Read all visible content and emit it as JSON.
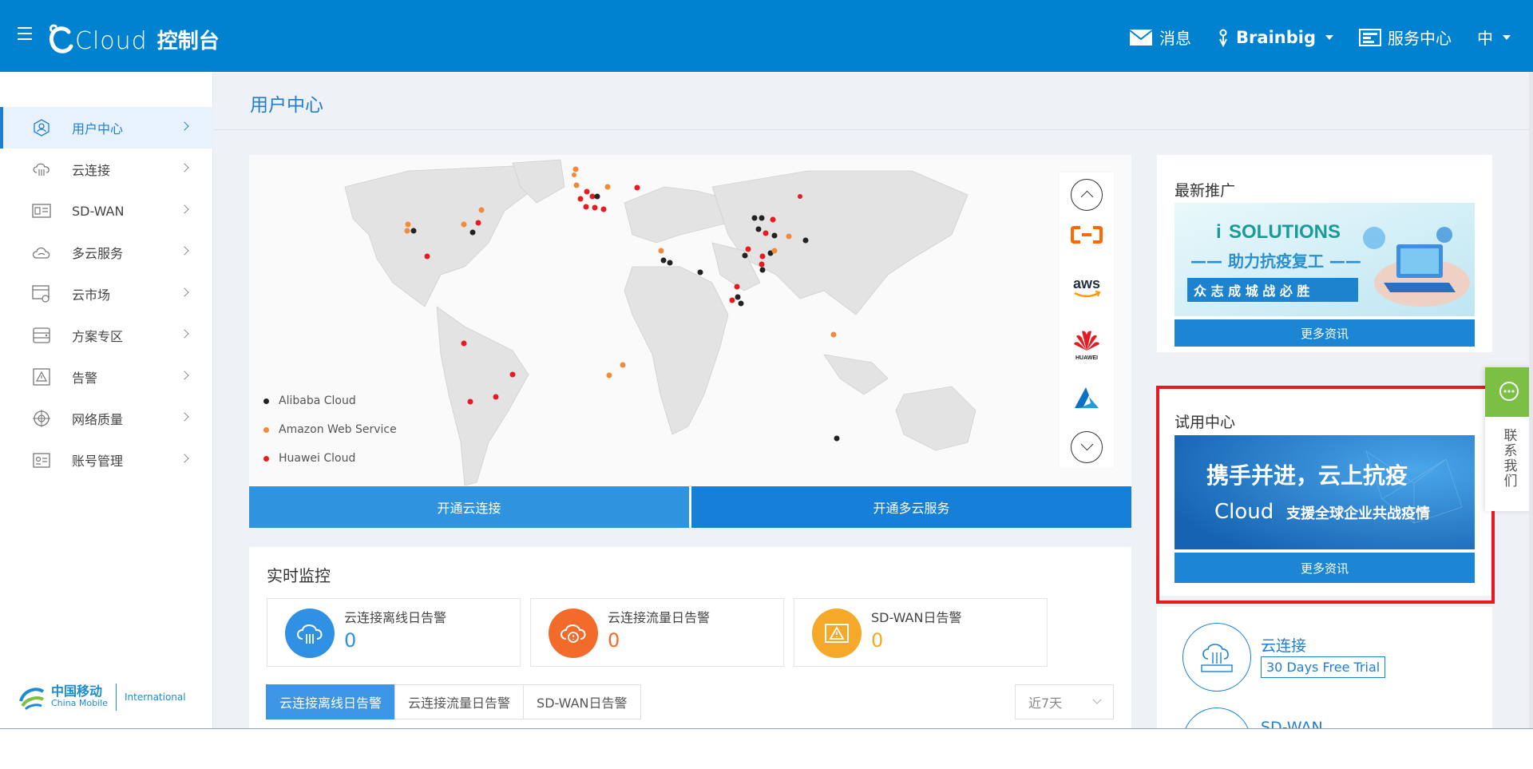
{
  "header": {
    "logo_text": "Cloud",
    "title": "控制台",
    "nav": {
      "messages": "消息",
      "user": "Brainbig",
      "service_center": "服务中心",
      "language": "中"
    }
  },
  "sidebar": {
    "items": [
      {
        "label": "用户中心",
        "icon": "user-center-icon"
      },
      {
        "label": "云连接",
        "icon": "cloud-connect-icon"
      },
      {
        "label": "SD-WAN",
        "icon": "sdwan-icon"
      },
      {
        "label": "多云服务",
        "icon": "multi-cloud-icon"
      },
      {
        "label": "云市场",
        "icon": "cloud-market-icon"
      },
      {
        "label": "方案专区",
        "icon": "solutions-icon"
      },
      {
        "label": "告警",
        "icon": "alarm-icon"
      },
      {
        "label": "网络质量",
        "icon": "network-quality-icon"
      },
      {
        "label": "账号管理",
        "icon": "account-icon"
      }
    ],
    "brand": {
      "cn": "中国移动",
      "en": "China Mobile",
      "intl": "International"
    }
  },
  "page": {
    "title": "用户中心"
  },
  "map": {
    "legend": [
      {
        "label": "Alibaba Cloud",
        "color": "#222222"
      },
      {
        "label": "Amazon Web Service",
        "color": "#f08b3a"
      },
      {
        "label": "Huawei Cloud",
        "color": "#e51b23"
      }
    ],
    "providers": [
      "alibaba-cloud-logo",
      "aws-logo",
      "huawei-logo",
      "azure-logo"
    ],
    "aws_text": "aws",
    "huawei_text": "HUAWEI",
    "buttons": {
      "open_cloud_connect": "开通云连接",
      "open_multi_cloud": "开通多云服务"
    }
  },
  "monitor": {
    "title": "实时监控",
    "stats": [
      {
        "label": "云连接离线日告警",
        "value": "0",
        "color": "#2f90e4"
      },
      {
        "label": "云连接流量日告警",
        "value": "0",
        "color": "#f26b2a"
      },
      {
        "label": "SD-WAN日告警",
        "value": "0",
        "color": "#f6a828"
      }
    ],
    "tabs": [
      "云连接离线日告警",
      "云连接流量日告警",
      "SD-WAN日告警"
    ],
    "range": "近7天"
  },
  "promo": {
    "title": "最新推广",
    "banner_heading": "SOLUTIONS",
    "banner_heading_prefix": "i",
    "banner_sub": "—— 助力抗疫复工 ——",
    "banner_line": "众 志 成 城 战 必 胜",
    "more": "更多资讯"
  },
  "trial": {
    "title": "试用中心",
    "banner_line1": "携手并进，云上抗疫",
    "banner_logo": "Cloud",
    "banner_line2": "支援全球企业共战疫情",
    "more": "更多资讯"
  },
  "services": [
    {
      "name": "云连接",
      "trial": "30 Days Free Trial"
    },
    {
      "name": "SD-WAN"
    }
  ],
  "contact": {
    "label": "联系我们"
  }
}
